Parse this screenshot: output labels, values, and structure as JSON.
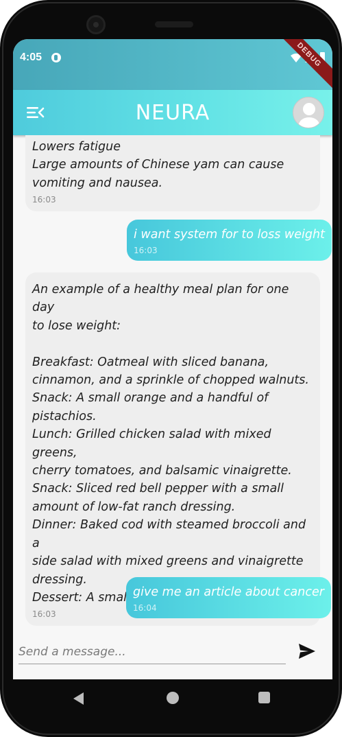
{
  "status_bar": {
    "time": "4:05",
    "debug_label": "DEBUG"
  },
  "app_bar": {
    "title": "NEURA",
    "menu_icon": "menu-collapse-icon",
    "avatar_icon": "user-avatar-icon"
  },
  "messages": [
    {
      "sender": "bot",
      "text": "Lowers fatigue\nLarge amounts of Chinese yam can cause\nvomiting and nausea.",
      "time": "16:03"
    },
    {
      "sender": "user",
      "text": "i want system for to loss weight",
      "time": "16:03"
    },
    {
      "sender": "bot",
      "text": "An example of a healthy meal plan for one day\nto lose weight:\n\nBreakfast: Oatmeal with sliced banana,\ncinnamon, and a sprinkle of chopped walnuts.\nSnack: A small orange and a handful of\npistachios.\nLunch: Grilled chicken salad with mixed greens,\ncherry tomatoes, and balsamic vinaigrette.\nSnack: Sliced red bell pepper with a small\namount of low-fat ranch dressing.\nDinner: Baked cod with steamed broccoli and a\nside salad with mixed greens and vinaigrette\ndressing.\nDessert: A small serving of fresh raspberries.",
      "time": "16:03"
    },
    {
      "sender": "user",
      "text": "give me an article about cancer",
      "time": "16:04"
    }
  ],
  "composer": {
    "placeholder": "Send a message...",
    "value": "",
    "send_icon": "send-icon"
  },
  "colors": {
    "status_bar": "#47a7b9",
    "app_bar_start": "#4fcbdc",
    "app_bar_end": "#78f1ea",
    "user_bubble_start": "#47c7db",
    "user_bubble_end": "#6cf0ea",
    "bot_bubble": "#eeeeee"
  },
  "nav": {
    "back_icon": "back-triangle-icon",
    "home_icon": "home-circle-icon",
    "recents_icon": "recents-square-icon"
  }
}
